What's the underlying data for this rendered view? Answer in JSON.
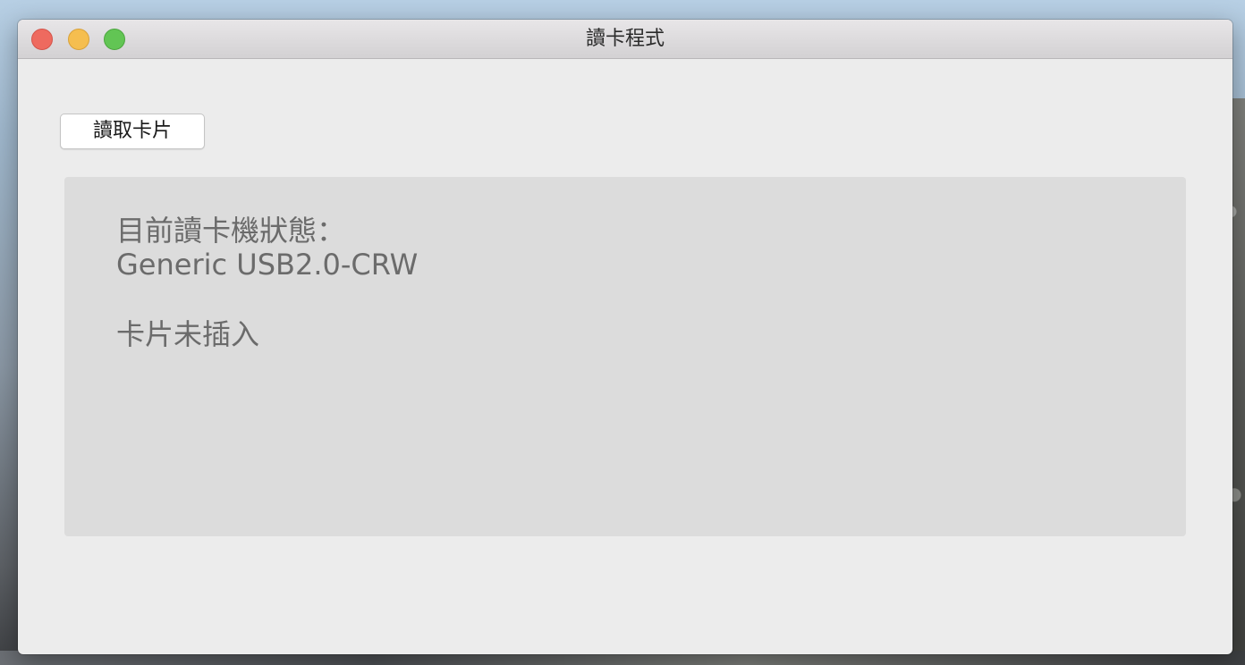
{
  "window": {
    "title": "讀卡程式"
  },
  "toolbar": {
    "read_card_label": "讀取卡片"
  },
  "status": {
    "label": "目前讀卡機狀態：",
    "reader_name": "Generic USB2.0-CRW",
    "card_state": "卡片未插入"
  },
  "colors": {
    "close": "#ee6a5f",
    "minimize": "#f5be4f",
    "zoom": "#62c554",
    "window_bg": "#ececec",
    "panel_bg": "#dcdcdc",
    "status_text": "#6b6b6b"
  }
}
